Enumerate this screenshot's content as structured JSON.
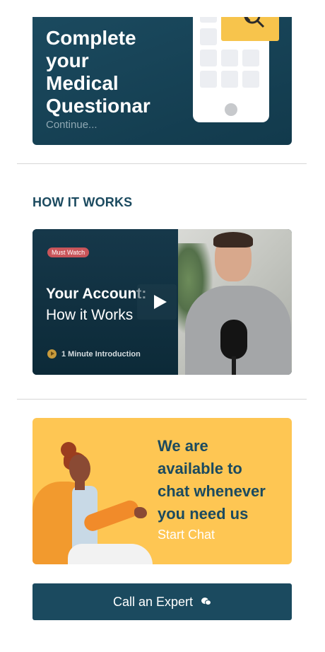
{
  "questionnaire": {
    "title": "Complete\nyour\nMedical\nQuestionar",
    "link": "Continue..."
  },
  "how_it_works": {
    "heading": "HOW IT WORKS",
    "video": {
      "badge": "Must Watch",
      "title_bold": "Your Account:",
      "title_regular": "How it Works",
      "duration": "1 Minute Introduction"
    }
  },
  "chat_promo": {
    "title": "We are\navailable to\nchat whenever\nyou need us",
    "link": "Start Chat"
  },
  "call_button": {
    "label": "Call an Expert"
  },
  "colors": {
    "primary": "#1b4a5f",
    "accent_yellow": "#fec653",
    "badge_red": "#c9555a"
  },
  "icons": [
    "play-icon",
    "chat-bubbles-icon",
    "magnifier-icon"
  ]
}
